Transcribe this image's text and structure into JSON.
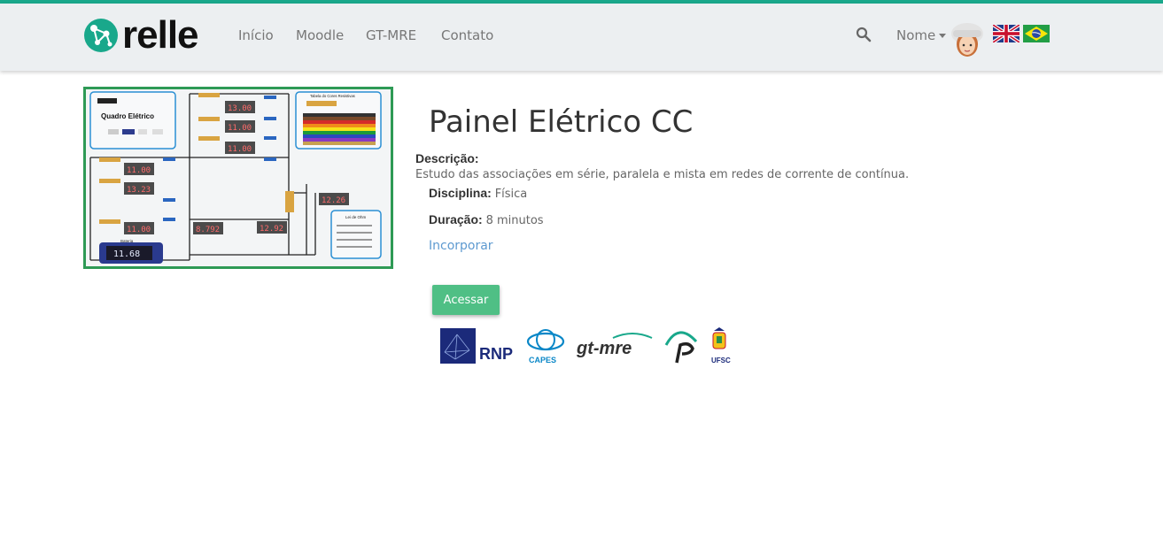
{
  "brand": {
    "name": "relle"
  },
  "nav": {
    "items": [
      "Início",
      "Moodle",
      "GT-MRE",
      "Contato"
    ],
    "user_label": "Nome"
  },
  "lab": {
    "title": "Painel Elétrico CC",
    "description_label": "Descrição:",
    "description": "Estudo das associações em série, paralela e mista em redes de corrente de contínua.",
    "discipline_label": "Disciplina:",
    "discipline": "Física",
    "duration_label": "Duração:",
    "duration": "8 minutos",
    "embed_label": "Incorporar",
    "access_label": "Acessar"
  },
  "panel_image": {
    "heading": "Quadro Elétrico",
    "table_heading": "Tabela do Cores Resistivas",
    "ohm_heading": "Lei de Ohm",
    "battery_label": "Bateria",
    "readings": [
      "13.00",
      "11.00",
      "11.00",
      "11.00",
      "11.00",
      "13.23",
      "11.00",
      "8.792",
      "12.92",
      "12.26",
      "11.68"
    ]
  },
  "partners": {
    "rnp": "RNP",
    "capes": "CAPES",
    "gtmre": "gt-mre",
    "ufsc": "UFSC"
  },
  "colors": {
    "accent": "#19a88b",
    "button": "#4fbf85",
    "link": "#5e9ad0",
    "navbar": "#eceff1"
  },
  "icons": {
    "brand": "relle-logo-icon",
    "search": "search-icon",
    "avatar": "user-avatar-icon",
    "lang_en": "uk-flag-icon",
    "lang_pt": "brazil-flag-icon"
  }
}
